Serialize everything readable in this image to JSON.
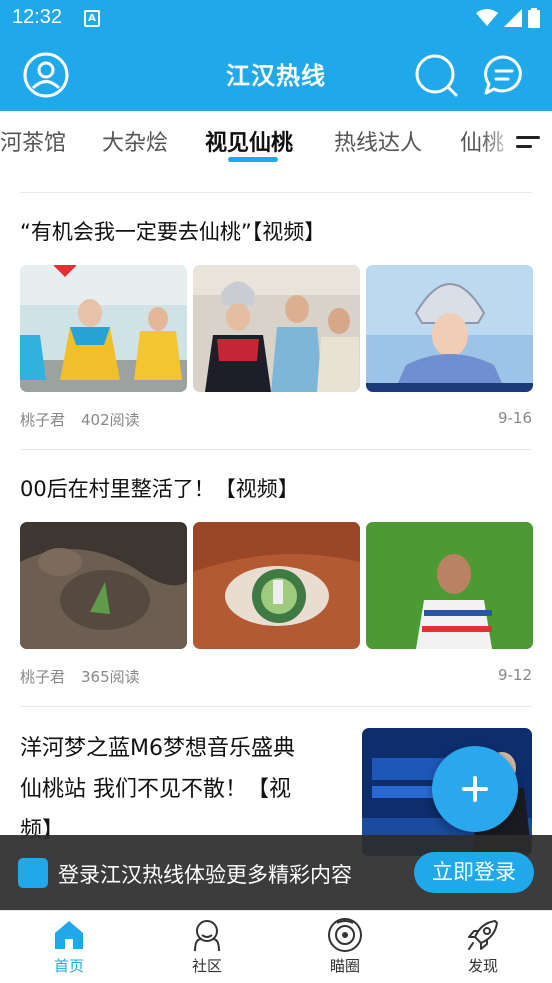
{
  "status_bar": {
    "time": "12:32",
    "notification_icon": "A"
  },
  "header": {
    "title": "江汉热线"
  },
  "tabs": [
    {
      "label": "河茶馆"
    },
    {
      "label": "大杂烩"
    },
    {
      "label": "视见仙桃"
    },
    {
      "label": "热线达人"
    },
    {
      "label": "仙桃"
    }
  ],
  "active_tab": "视见仙桃",
  "articles": [
    {
      "title": "“有机会我一定要去仙桃”【视频】",
      "author": "桃子君",
      "reads": "402阅读",
      "date": "9-16"
    },
    {
      "title": "00后在村里整活了！【视频】",
      "author": "桃子君",
      "reads": "365阅读",
      "date": "9-12"
    },
    {
      "title_lines": [
        "洋河梦之蓝M6梦想音乐盛典",
        "仙桃站 我们不见不散！【视",
        "频】"
      ]
    }
  ],
  "login_banner": {
    "text": "登录江汉热线体验更多精彩内容",
    "button": "立即登录"
  },
  "bottom_nav": [
    {
      "label": "首页",
      "icon": "home-icon",
      "active": true
    },
    {
      "label": "社区",
      "icon": "community-icon",
      "active": false
    },
    {
      "label": "瞄圈",
      "icon": "circle-icon",
      "active": false
    },
    {
      "label": "发现",
      "icon": "rocket-icon",
      "active": false
    }
  ],
  "colors": {
    "brand": "#1fa8ea",
    "banner_bg": "#2d2d2d"
  }
}
